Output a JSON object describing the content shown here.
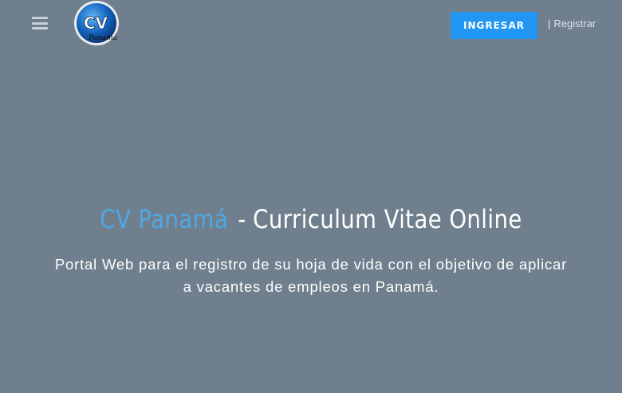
{
  "header": {
    "login_label": "INGRESAR",
    "separator": "|",
    "register_label": "Registrar",
    "logo": {
      "text_main": "CV",
      "text_sub": "Panamá"
    }
  },
  "hero": {
    "brand": "CV Panamá",
    "dash": "-",
    "title_rest": "Curriculum Vitae Online",
    "subtitle_line1": "Portal Web para el registro de su hoja de vida con el objetivo de aplicar",
    "subtitle_line2": "a vacantes de empleos en Panamá."
  },
  "colors": {
    "background": "#6f7f8d",
    "accent": "#2196f3",
    "brand_text": "#4ea8e6"
  }
}
